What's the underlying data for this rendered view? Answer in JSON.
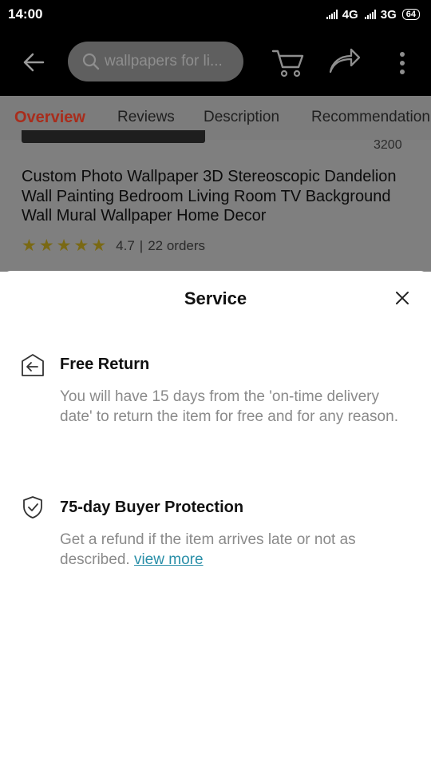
{
  "status_bar": {
    "time": "14:00",
    "network_1": "4G",
    "network_2": "3G",
    "battery": "64"
  },
  "app_bar": {
    "search_placeholder": "wallpapers for li...",
    "icons": [
      "back-arrow-icon",
      "search-icon",
      "cart-icon",
      "share-icon",
      "more-vertical-icon"
    ]
  },
  "tabs": [
    {
      "label": "Overview",
      "active": true
    },
    {
      "label": "Reviews",
      "active": false
    },
    {
      "label": "Description",
      "active": false
    },
    {
      "label": "Recommendation",
      "active": false
    }
  ],
  "product": {
    "count": "3200",
    "title": "Custom Photo Wallpaper 3D Stereoscopic Dandelion Wall Painting Bedroom Living Room TV Background Wall Mural Wallpaper Home Decor",
    "rating": "4.7",
    "separator": "|",
    "orders": "22 orders",
    "stars": 5
  },
  "sheet": {
    "title": "Service",
    "services": [
      {
        "icon": "return-box-icon",
        "title": "Free Return",
        "description": "You will have 15 days from the 'on-time delivery date' to return the item for free and for any reason."
      },
      {
        "icon": "shield-check-icon",
        "title": "75-day Buyer Protection",
        "description": "Get a refund if the item arrives late or not as described.",
        "link": "view more"
      }
    ]
  },
  "colors": {
    "active_tab": "#a82d1c",
    "link": "#2a8fa8",
    "star": "#7a6914"
  }
}
